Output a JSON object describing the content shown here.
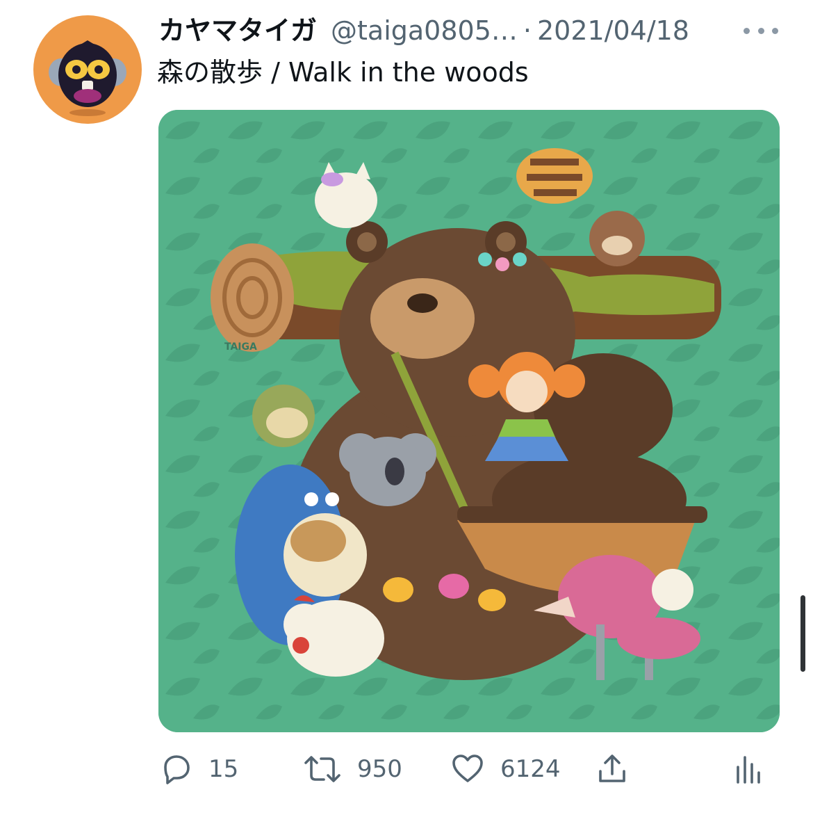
{
  "tweet": {
    "display_name": "カヤマタイガ",
    "handle": "@taiga0805…",
    "separator": "·",
    "date": "2021/04/18",
    "text": "森の散歩 / Walk in the woods",
    "media": {
      "signature": "TAIGA"
    }
  },
  "actions": {
    "replies": "15",
    "retweets": "950",
    "likes": "6124"
  },
  "icons": {
    "more": "more-horizontal-icon",
    "reply": "reply-icon",
    "retweet": "retweet-icon",
    "like": "heart-icon",
    "share": "share-icon",
    "analytics": "analytics-icon"
  },
  "colors": {
    "text_primary": "#0f1419",
    "text_secondary": "#536471",
    "avatar_bg": "#ef9a48",
    "media_bg": "#55b28a"
  }
}
